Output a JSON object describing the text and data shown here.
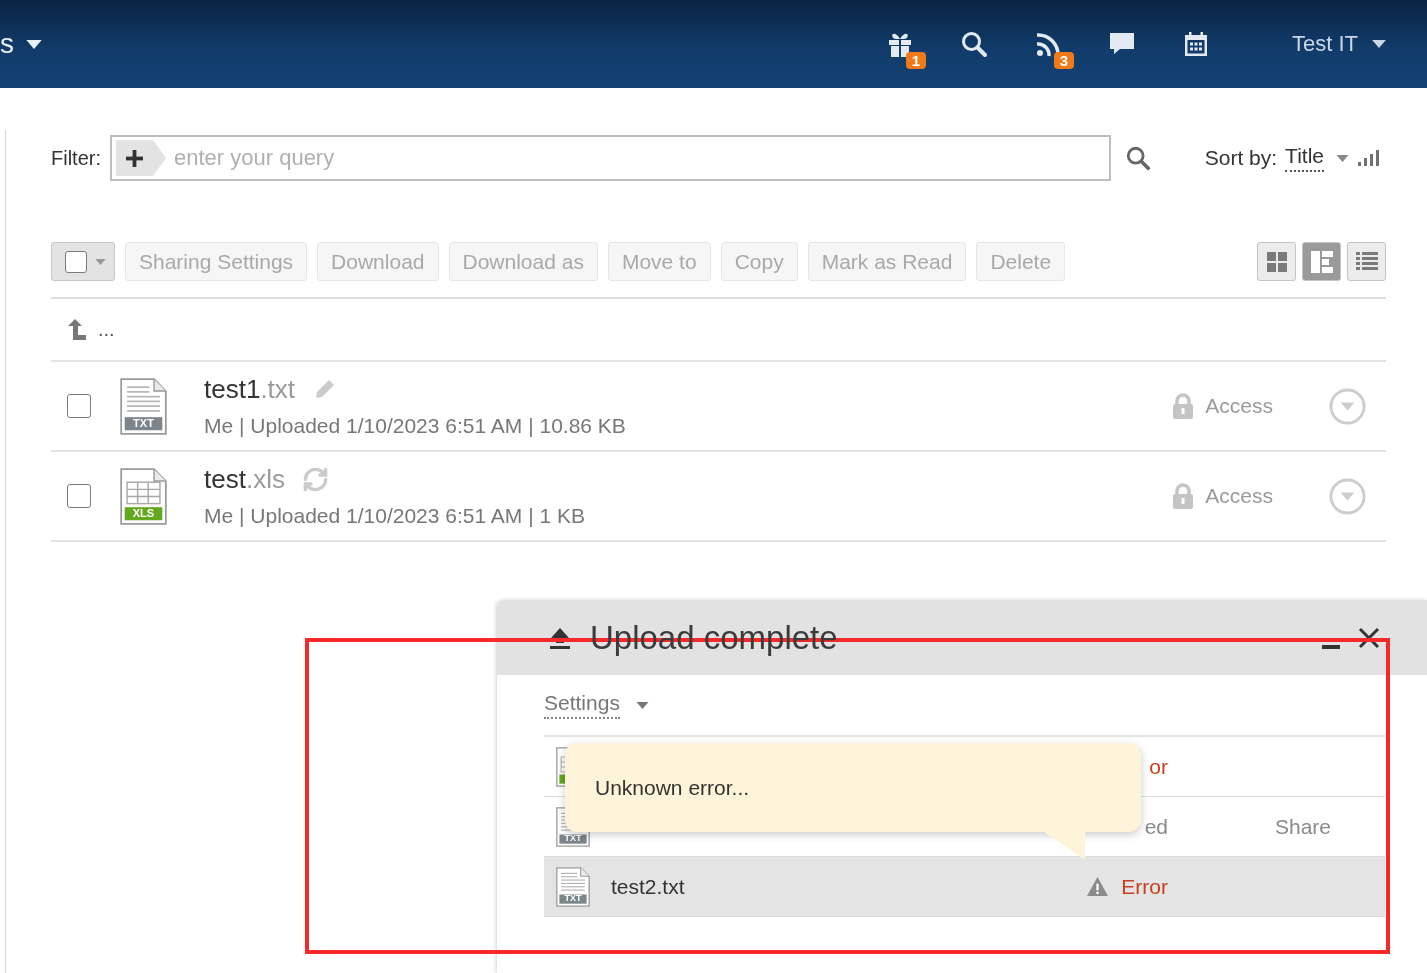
{
  "top_bar": {
    "menu_label": "s",
    "icons": [
      {
        "kind": "gift",
        "badge": "1"
      },
      {
        "kind": "search"
      },
      {
        "kind": "feed",
        "badge": "3"
      },
      {
        "kind": "chat"
      },
      {
        "kind": "calendar"
      }
    ],
    "user": "Test IT"
  },
  "filter": {
    "label": "Filter:",
    "placeholder": "enter your query"
  },
  "sort": {
    "label": "Sort by:",
    "value": "Title"
  },
  "toolbar": {
    "select_all": {
      "checked": false
    },
    "buttons": [
      {
        "label": "Sharing Settings",
        "disabled": true
      },
      {
        "label": "Download",
        "disabled": true
      },
      {
        "label": "Download as",
        "disabled": true
      },
      {
        "label": "Move to",
        "disabled": true
      },
      {
        "label": "Copy",
        "disabled": true
      },
      {
        "label": "Mark as Read",
        "disabled": true
      },
      {
        "label": "Delete",
        "disabled": true
      }
    ],
    "view_modes": [
      {
        "kind": "tiles",
        "selected": false
      },
      {
        "kind": "compact",
        "selected": true
      },
      {
        "kind": "list",
        "selected": false
      }
    ]
  },
  "parent_folder": {
    "label": "..."
  },
  "files": [
    {
      "checked": false,
      "kind": "txt",
      "badge": "TXT",
      "name": "test1",
      "extension": ".txt",
      "action": {
        "kind": "edit"
      },
      "meta": "Me | Uploaded 1/10/2023 6:51 AM | 10.86 KB",
      "access": "Access"
    },
    {
      "checked": false,
      "kind": "xls",
      "badge": "XLS",
      "name": "test",
      "extension": ".xls",
      "action": {
        "kind": "sync"
      },
      "meta": "Me | Uploaded 1/10/2023 6:51 AM | 1 KB",
      "access": "Access"
    }
  ],
  "upload_panel": {
    "title": "Upload complete",
    "settings": "Settings",
    "items": [
      {
        "kind": "xls",
        "selected": false,
        "error": true,
        "status": "or",
        "warning_icon": false
      },
      {
        "kind": "txt",
        "badge": "TXT",
        "selected": false,
        "error": false,
        "status": "ed",
        "share": "Share",
        "warning_icon": false
      },
      {
        "kind": "txt",
        "badge": "TXT",
        "name": "test2.txt",
        "selected": true,
        "error": true,
        "status": "Error",
        "warning_icon": true
      }
    ],
    "tooltip": "Unknown error..."
  }
}
